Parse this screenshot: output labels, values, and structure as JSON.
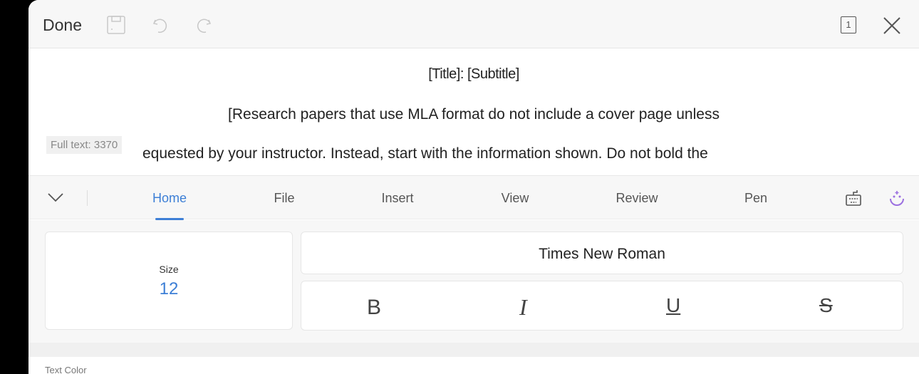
{
  "topbar": {
    "done": "Done",
    "page_count": "1"
  },
  "document": {
    "title_line": "[Title]: [Subtitle]",
    "line2": "[Research papers that use MLA format do not include a cover page unless",
    "line3": "equested by your instructor. Instead, start with the information shown. Do not bold the",
    "full_text_badge": "Full text: 3370"
  },
  "tabs": [
    {
      "label": "Home"
    },
    {
      "label": "File"
    },
    {
      "label": "Insert"
    },
    {
      "label": "View"
    },
    {
      "label": "Review"
    },
    {
      "label": "Pen"
    }
  ],
  "format": {
    "size_label": "Size",
    "size_value": "12",
    "font_name": "Times New Roman",
    "bold": "B",
    "italic": "I",
    "underline": "U",
    "strike": "S"
  },
  "text_color_label": "Text Color",
  "colors": {
    "accent": "#3d7fd6",
    "assistant": "#9b6fe0"
  }
}
